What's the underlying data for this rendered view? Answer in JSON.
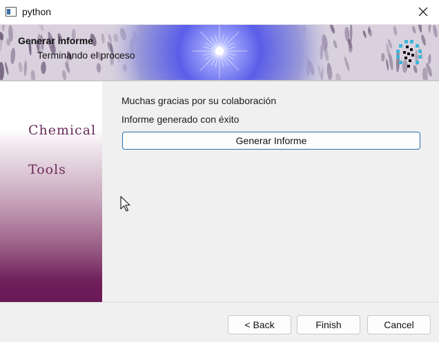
{
  "window": {
    "title": "python",
    "app_icon": "window-icon",
    "close_icon": "close-icon"
  },
  "banner": {
    "title": "Generar informe",
    "subtitle": "Terminando el proceso",
    "logo_icon": "molecule-logo-icon"
  },
  "sidebar": {
    "words": [
      "Chemical",
      "Tools"
    ]
  },
  "content": {
    "line1": "Muchas gracias por su colaboración",
    "line2": "Informe generado con éxito",
    "generate_button": "Generar Informe"
  },
  "footer": {
    "back": "< Back",
    "finish": "Finish",
    "cancel": "Cancel"
  }
}
